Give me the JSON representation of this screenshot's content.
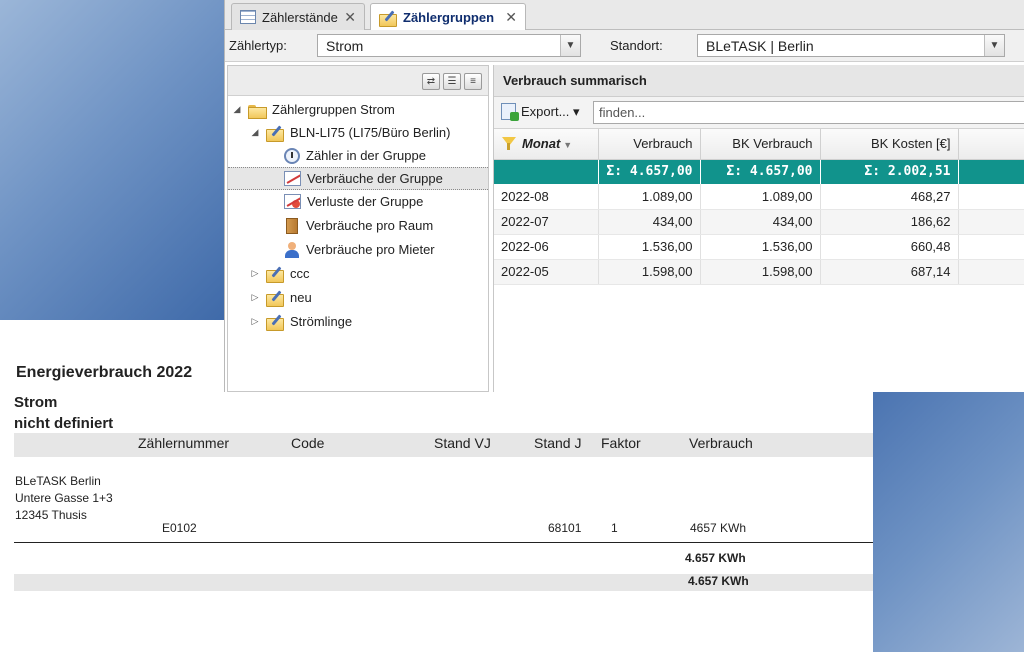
{
  "tabs": [
    {
      "label": "Zählerstände",
      "active": false
    },
    {
      "label": "Zählergruppen",
      "active": true
    }
  ],
  "filters": {
    "type_label": "Zählertyp:",
    "type_value": "Strom",
    "location_label": "Standort:",
    "location_value": "BLeTASK | Berlin"
  },
  "tree": {
    "nodes": [
      {
        "label": "Zählergruppen Strom",
        "icon": "folder-icon",
        "expanded": true
      },
      {
        "label": "BLN-LI75 (LI75/Büro Berlin)",
        "icon": "folder-edit-icon",
        "expanded": true
      },
      {
        "label": "Zähler in der Gruppe",
        "icon": "meter-icon"
      },
      {
        "label": "Verbräuche der Gruppe",
        "icon": "chart-icon",
        "selected": true
      },
      {
        "label": "Verluste der Gruppe",
        "icon": "chart-loss-icon"
      },
      {
        "label": "Verbräuche pro Raum",
        "icon": "door-icon"
      },
      {
        "label": "Verbräuche pro Mieter",
        "icon": "person-icon"
      },
      {
        "label": "ccc",
        "icon": "folder-edit-icon",
        "expanded": false
      },
      {
        "label": "neu",
        "icon": "folder-edit-icon",
        "expanded": false
      },
      {
        "label": "Strömlinge",
        "icon": "folder-edit-icon",
        "expanded": false
      }
    ]
  },
  "grid": {
    "title": "Verbrauch summarisch",
    "export_label": "Export... ▾",
    "search_placeholder": "finden...",
    "columns": [
      "Monat",
      "Verbrauch",
      "BK Verbrauch",
      "BK Kosten [€]"
    ],
    "sums": [
      "Σ: 4.657,00",
      "Σ: 4.657,00",
      "Σ: 2.002,51"
    ],
    "rows": [
      [
        "2022-08",
        "1.089,00",
        "1.089,00",
        "468,27"
      ],
      [
        "2022-07",
        "434,00",
        "434,00",
        "186,62"
      ],
      [
        "2022-06",
        "1.536,00",
        "1.536,00",
        "660,48"
      ],
      [
        "2022-05",
        "1.598,00",
        "1.598,00",
        "687,14"
      ]
    ]
  },
  "report": {
    "title": "Energieverbrauch 2022",
    "sub1": "Strom",
    "sub2": "nicht definiert",
    "headers": [
      "Zählernummer",
      "Code",
      "Stand VJ",
      "Stand J",
      "Faktor",
      "Verbrauch"
    ],
    "address": [
      "BLeTASK Berlin",
      "Untere Gasse 1+3",
      "12345 Thusis"
    ],
    "row": {
      "meter": "E0102",
      "stand_j": "68101",
      "factor": "1",
      "usage": "4657 KWh"
    },
    "total": "4.657 KWh",
    "grand_total": "4.657 KWh"
  },
  "colors": {
    "sum_row": "#11938c",
    "active_tab_text": "#0f2d6e"
  }
}
